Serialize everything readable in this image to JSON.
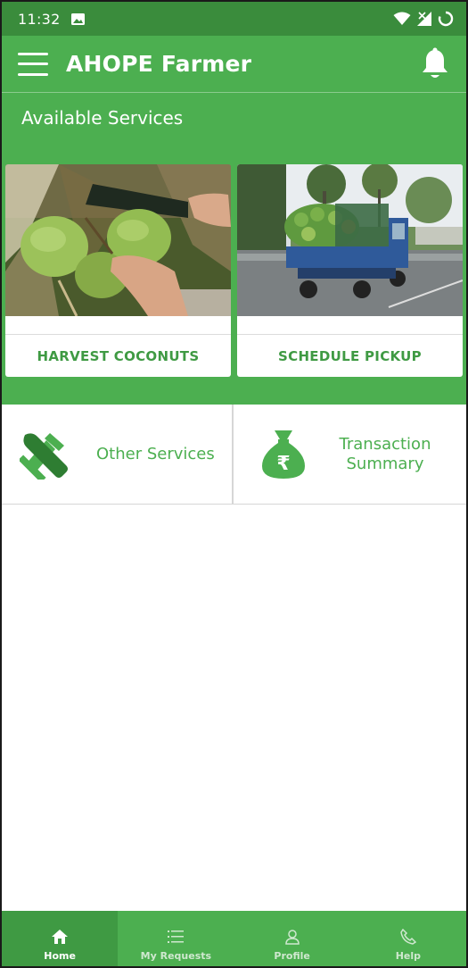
{
  "status_bar": {
    "time": "11:32"
  },
  "app_bar": {
    "title": "AHOPE Farmer"
  },
  "section": {
    "title": "Available Services"
  },
  "cards": [
    {
      "label": "HARVEST COCONUTS"
    },
    {
      "label": "SCHEDULE PICKUP"
    }
  ],
  "tiles": [
    {
      "label": "Other Services"
    },
    {
      "label": "Transaction Summary"
    }
  ],
  "bottom_nav": [
    {
      "label": "Home",
      "active": true
    },
    {
      "label": "My Requests",
      "active": false
    },
    {
      "label": "Profile",
      "active": false
    },
    {
      "label": "Help",
      "active": false
    }
  ],
  "colors": {
    "primary": "#4caf50",
    "primary_dark": "#3a8c3c",
    "accent_text": "#3f9a43"
  }
}
